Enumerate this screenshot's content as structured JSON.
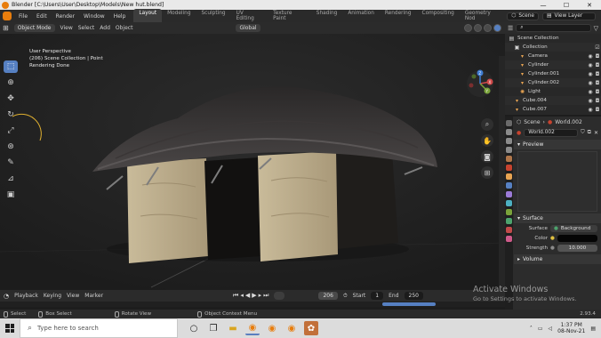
{
  "window": {
    "title": "Blender [C:\\Users\\User\\Desktop\\Models\\New hut.blend]",
    "controls": [
      "—",
      "☐",
      "✕"
    ]
  },
  "menu": [
    "File",
    "Edit",
    "Render",
    "Window",
    "Help"
  ],
  "workspaces": [
    "Layout",
    "Modeling",
    "Sculpting",
    "UV Editing",
    "Texture Paint",
    "Shading",
    "Animation",
    "Rendering",
    "Compositing",
    "Geometry Nod"
  ],
  "active_workspace": "Layout",
  "scene_field": "Scene",
  "view_layer_field": "View Layer",
  "viewport_header": {
    "mode": "Object Mode",
    "items": [
      "View",
      "Select",
      "Add",
      "Object"
    ],
    "orientation": "Global",
    "options": "Options"
  },
  "viewport_info": {
    "line1": "User Perspective",
    "line2": "(206) Scene Collection | Point",
    "line3": "Rendering Done"
  },
  "gizmo_axes": {
    "x": "X",
    "y": "Y",
    "z": "Z"
  },
  "outliner": {
    "root": "Scene Collection",
    "items": [
      {
        "name": "Collection",
        "icon": "collection-icon",
        "level": 0
      },
      {
        "name": "Camera",
        "icon": "camera-icon",
        "level": 1
      },
      {
        "name": "Cylinder",
        "icon": "mesh-icon",
        "level": 1
      },
      {
        "name": "Cylinder.001",
        "icon": "mesh-icon",
        "level": 1
      },
      {
        "name": "Cylinder.002",
        "icon": "mesh-icon",
        "level": 1
      },
      {
        "name": "Light",
        "icon": "light-icon",
        "level": 1
      },
      {
        "name": "Cube.004",
        "icon": "mesh-icon",
        "level": 0
      },
      {
        "name": "Cube.007",
        "icon": "mesh-icon",
        "level": 0
      }
    ]
  },
  "properties": {
    "breadcrumb": [
      "Scene",
      "World.002"
    ],
    "world_name": "World.002",
    "preview_label": "Preview",
    "surface_label": "Surface",
    "surface_value": "Background",
    "color_label": "Color",
    "strength_label": "Strength",
    "strength_value": "10.000",
    "volume_label": "Volume"
  },
  "timeline": {
    "menus": [
      "Playback",
      "Keying",
      "View",
      "Marker"
    ],
    "current_frame": "206",
    "start_label": "Start",
    "start_value": "1",
    "end_label": "End",
    "end_value": "250"
  },
  "statusbar": {
    "select": "Select",
    "box_select": "Box Select",
    "rotate_view": "Rotate View",
    "context_menu": "Object Context Menu",
    "version": "2.93.4"
  },
  "watermark": {
    "line1": "Activate Windows",
    "line2": "Go to Settings to activate Windows."
  },
  "taskbar": {
    "search_placeholder": "Type here to search",
    "time": "1:37 PM",
    "date": "08-Nov-21"
  },
  "colors": {
    "accent": "#5680c2",
    "blender_orange": "#e87d0d",
    "viewport_bg": "#3c3c3c"
  }
}
